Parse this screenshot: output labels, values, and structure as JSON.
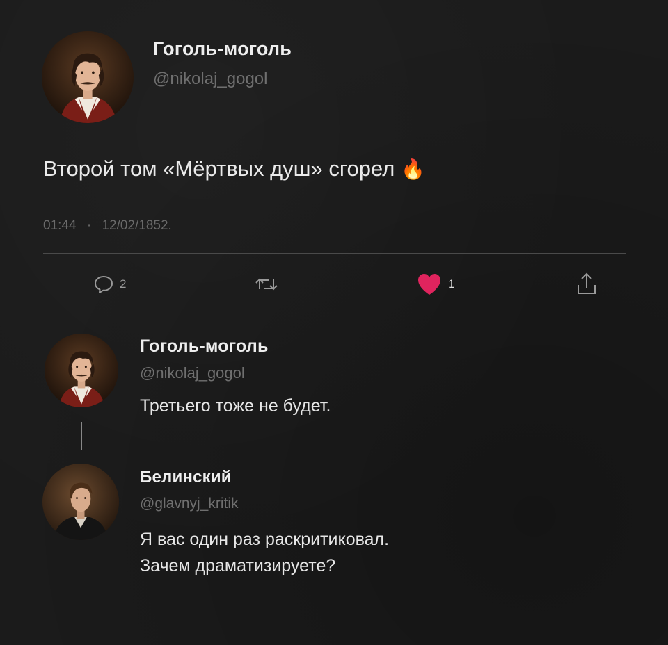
{
  "tweet": {
    "author": {
      "name": "Гоголь-моголь",
      "handle": "@nikolaj_gogol",
      "avatar_icon": "gogol-portrait-icon"
    },
    "text": "Второй том «Мёртвых душ» сгорел",
    "emoji": "🔥",
    "time": "01:44",
    "separator": "·",
    "date": "12/02/1852."
  },
  "actions": {
    "reply_count": "2",
    "retweet_count": "",
    "like_count": "1",
    "like_color": "#e0245e"
  },
  "replies": [
    {
      "name": "Гоголь-моголь",
      "handle": "@nikolaj_gogol",
      "text": "Третьего тоже не будет.",
      "avatar_icon": "gogol-portrait-icon"
    },
    {
      "name": "Белинский",
      "handle": "@glavnyj_kritik",
      "text_line1": "Я вас один раз раскритиковал.",
      "text_line2": "Зачем драматизируете?",
      "avatar_icon": "belinsky-portrait-icon"
    }
  ]
}
